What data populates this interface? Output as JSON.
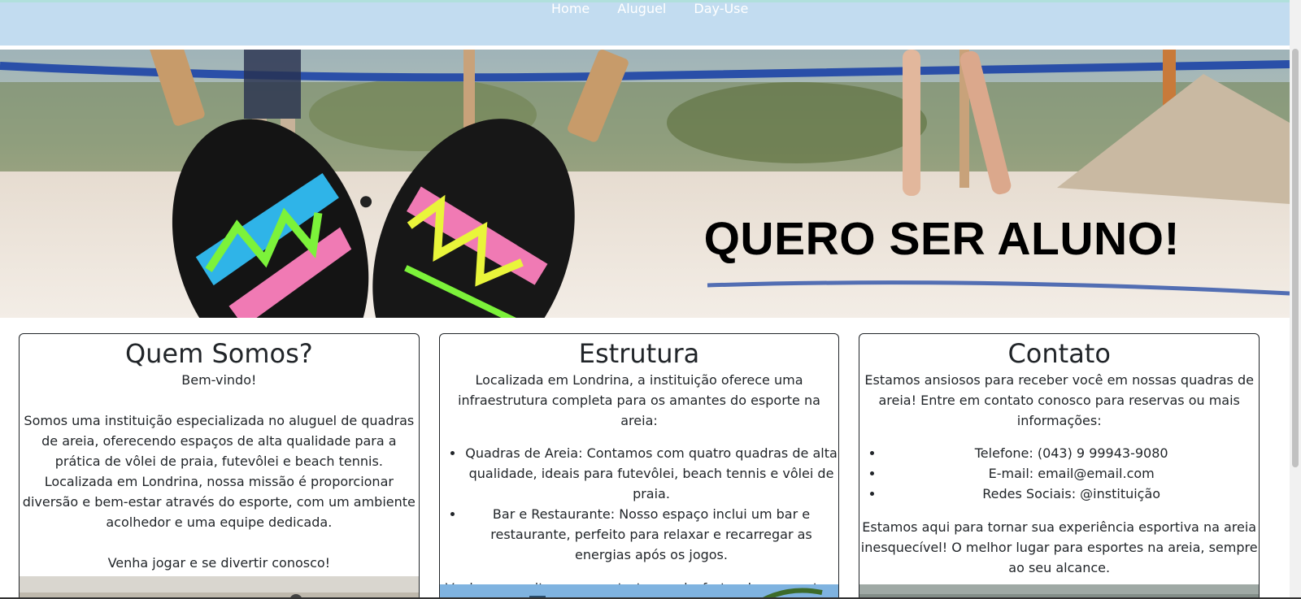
{
  "nav": {
    "items": [
      {
        "label": "Home"
      },
      {
        "label": "Aluguel"
      },
      {
        "label": "Day-Use"
      }
    ]
  },
  "hero": {
    "title": "QUERO SER ALUNO!"
  },
  "cards": [
    {
      "title": "Quem Somos?",
      "paragraphs": [
        "Bem-vindo!",
        "Somos uma instituição especializada no aluguel de quadras de areia, oferecendo espaços de alta qualidade para a prática de vôlei de praia, futevôlei e beach tennis. Localizada em Londrina, nossa missão é proporcionar diversão e bem-estar através do esporte, com um ambiente acolhedor e uma equipe dedicada.",
        "Venha jogar e se divertir conosco!"
      ]
    },
    {
      "title": "Estrutura",
      "intro": "Localizada em Londrina, a instituição oferece uma infraestrutura completa para os amantes do esporte na areia:",
      "list": [
        "Quadras de Areia: Contamos com quatro quadras de alta qualidade, ideais para futevôlei, beach tennis e vôlei de praia.",
        "Bar e Restaurante: Nosso espaço inclui um bar e restaurante, perfeito para relaxar e recarregar as energias após os jogos."
      ],
      "outro": "Venha aproveitar nossa estrutura e desfrutar de momentos memoráveis com amigos e familiares!"
    },
    {
      "title": "Contato",
      "intro": "Estamos ansiosos para receber você em nossas quadras de areia! Entre em contato conosco para reservas ou mais informações:",
      "list": [
        "Telefone: (043) 9 99943-9080",
        "E-mail: email@email.com",
        "Redes Sociais: @instituição"
      ],
      "outro": "Estamos aqui para tornar sua experiência esportiva na areia inesquecível! O melhor lugar para esportes na areia, sempre ao seu alcance."
    }
  ],
  "colors": {
    "topbar": "#c2dcf0",
    "text": "#212529",
    "racket_green": "#7cf23a",
    "racket_cyan": "#2fb4e8",
    "racket_pink": "#f07ab4"
  }
}
